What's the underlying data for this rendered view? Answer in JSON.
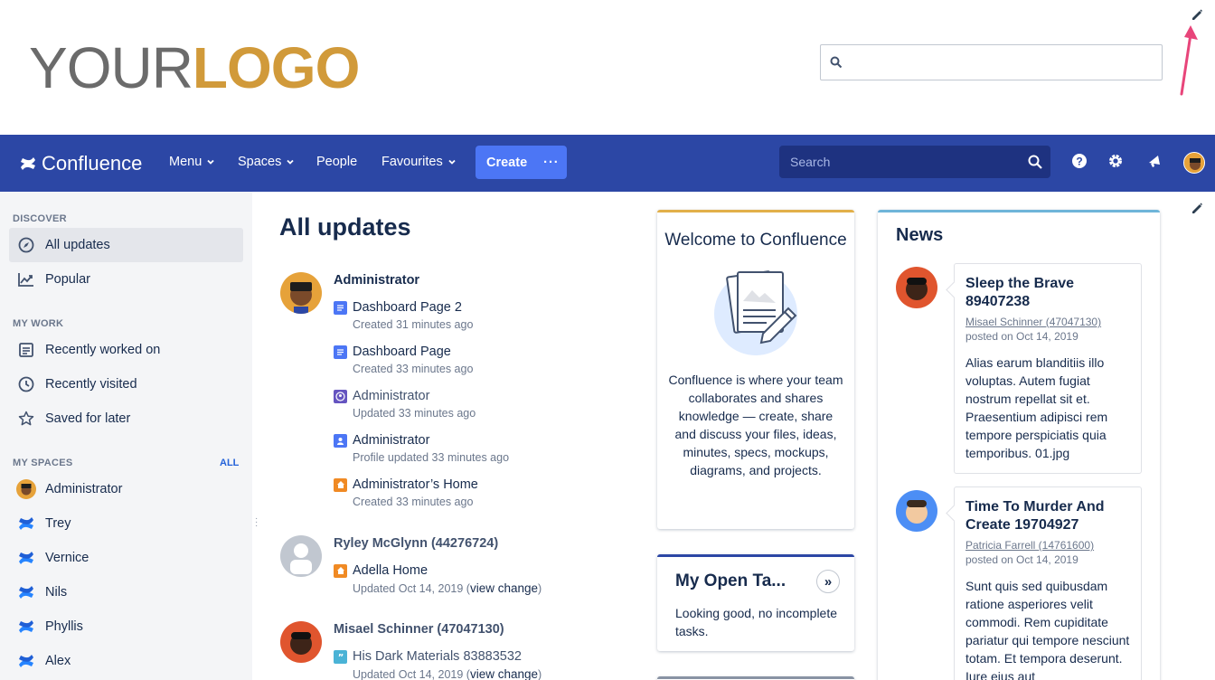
{
  "banner": {
    "logo_part1": "YOUR",
    "logo_part2": "LOGO",
    "search_placeholder": ""
  },
  "nav": {
    "brand": "Confluence",
    "menu": "Menu",
    "spaces": "Spaces",
    "people": "People",
    "favourites": "Favourites",
    "create": "Create",
    "create_more": "···",
    "search_placeholder": "Search"
  },
  "sidebar": {
    "discover_heading": "DISCOVER",
    "discover_items": [
      {
        "label": "All updates",
        "icon": "compass-icon"
      },
      {
        "label": "Popular",
        "icon": "trending-icon"
      }
    ],
    "mywork_heading": "MY WORK",
    "mywork_items": [
      {
        "label": "Recently worked on",
        "icon": "document-list-icon"
      },
      {
        "label": "Recently visited",
        "icon": "clock-icon"
      },
      {
        "label": "Saved for later",
        "icon": "star-icon"
      }
    ],
    "myspaces_heading": "MY SPACES",
    "myspaces_all": "ALL",
    "spaces": [
      {
        "label": "Administrator",
        "icon": "user-avatar-icon"
      },
      {
        "label": "Trey",
        "icon": "confluence-space-icon"
      },
      {
        "label": "Vernice",
        "icon": "confluence-space-icon"
      },
      {
        "label": "Nils",
        "icon": "confluence-space-icon"
      },
      {
        "label": "Phyllis",
        "icon": "confluence-space-icon"
      },
      {
        "label": "Alex",
        "icon": "confluence-space-icon"
      }
    ]
  },
  "main": {
    "title": "All updates",
    "groups": [
      {
        "user": "Administrator",
        "entries": [
          {
            "title": "Dashboard Page 2",
            "meta": "Created 31 minutes ago",
            "icon": "page-icon"
          },
          {
            "title": "Dashboard Page",
            "meta": "Created 33 minutes ago",
            "icon": "page-icon"
          },
          {
            "title": "Administrator",
            "meta": "Updated 33 minutes ago",
            "icon": "personal-space-icon"
          },
          {
            "title": "Administrator",
            "meta": "Profile updated 33 minutes ago",
            "icon": "profile-icon"
          },
          {
            "title": "Administrator’s Home",
            "meta": "Created 33 minutes ago",
            "icon": "home-icon"
          }
        ]
      },
      {
        "user": "Ryley McGlynn (44276724)",
        "entries": [
          {
            "title": "Adella Home",
            "meta": "Updated Oct 14, 2019 (",
            "link": "view change",
            "close": ")",
            "icon": "home-icon"
          }
        ]
      },
      {
        "user": "Misael Schinner (47047130)",
        "entries": [
          {
            "title": "His Dark Materials 83883532",
            "meta": "Updated Oct 14, 2019 (",
            "link": "view change",
            "close": ")",
            "icon": "quote-icon"
          }
        ]
      }
    ]
  },
  "welcome": {
    "title": "Welcome to Confluence",
    "body": "Confluence is where your team collaborates and shares knowledge — create, share and discuss your files, ideas, minutes, specs, mockups, diagrams, and projects."
  },
  "tasks": {
    "title": "My Open Ta...",
    "go": "»",
    "body": "Looking good, no incomplete tasks."
  },
  "news": {
    "title": "News",
    "posts": [
      {
        "title": "Sleep the Brave 89407238",
        "author": "Misael Schinner (47047130)",
        "date": "posted on Oct 14, 2019",
        "text": "Alias earum blanditiis illo voluptas. Autem fugiat nostrum repellat sit et. Praesentium adipisci rem tempore perspiciatis quia temporibus. 01.jpg"
      },
      {
        "title": "Time To Murder And Create 19704927",
        "author": "Patricia Farrell (14761600)",
        "date": "posted on Oct 14, 2019",
        "text": "Sunt quis sed quibusdam ratione asperiores velit commodi. Rem cupiditate pariatur qui tempore nesciunt totam. Et tempora deserunt. Iure eius aut"
      }
    ]
  },
  "colors": {
    "nav_bg": "#2c47a5",
    "create_bg": "#4c76f5",
    "logo_gold": "#d19a3a",
    "arrow_pink": "#e8457a"
  }
}
